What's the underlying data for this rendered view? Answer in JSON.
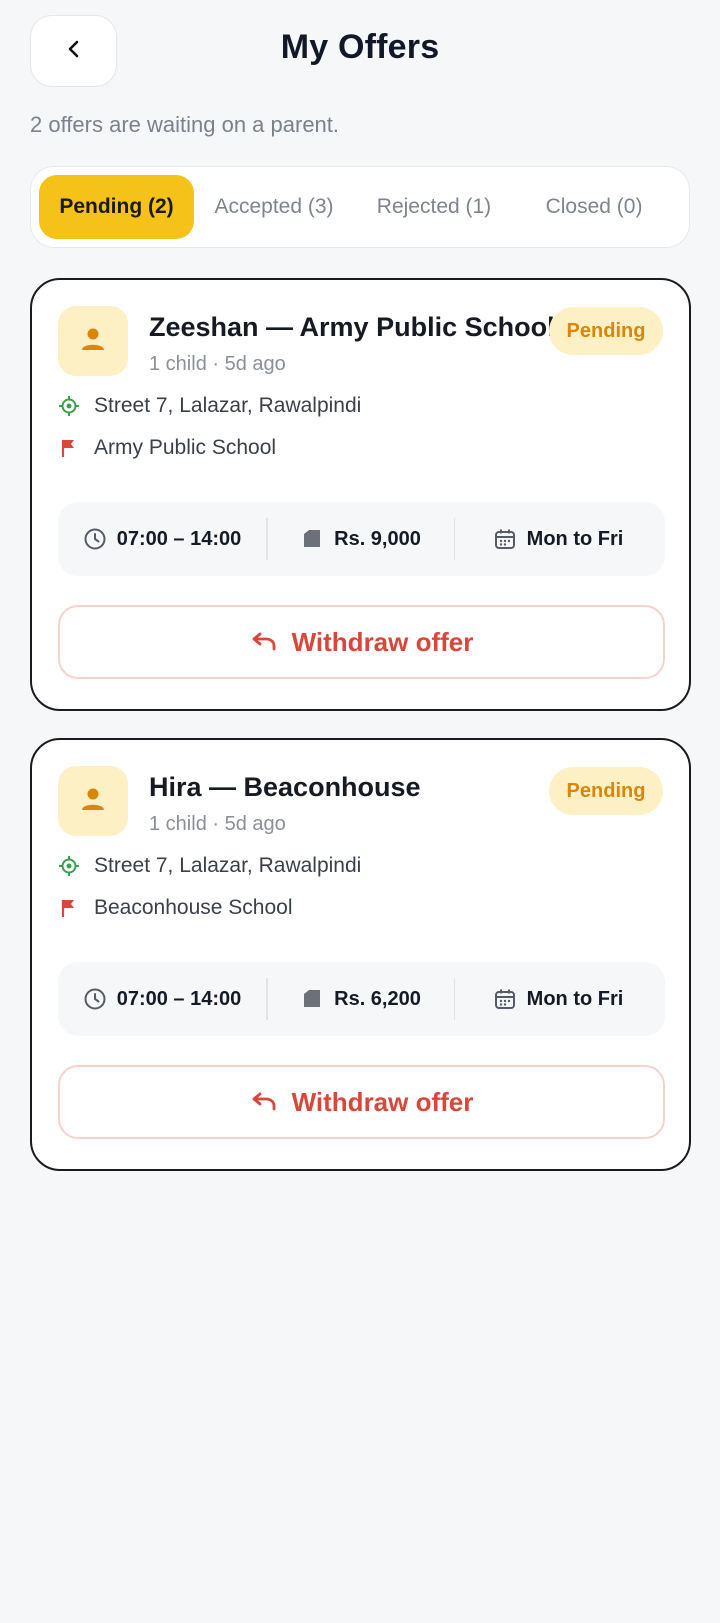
{
  "header": {
    "title": "My Offers",
    "back_icon": "chevron-left-icon"
  },
  "subtitle": "2 offers are waiting on a parent.",
  "tabs": [
    {
      "label": "Pending (2)",
      "active": true
    },
    {
      "label": "Accepted (3)",
      "active": false
    },
    {
      "label": "Rejected (1)",
      "active": false
    },
    {
      "label": "Closed (0)",
      "active": false
    }
  ],
  "colors": {
    "accent": "#f5c21a",
    "badge_text": "#d9860a",
    "danger": "#d9463a",
    "location": "#3aa04a"
  },
  "offers": [
    {
      "title": "Zeeshan — Army Public School",
      "status": "Pending",
      "meta": "1 child · 5d ago",
      "address": "Street 7, Lalazar, Rawalpindi",
      "school": "Army Public School",
      "time": "07:00 – 14:00",
      "price": "Rs. 9,000",
      "days": "Mon to Fri",
      "action": "Withdraw offer"
    },
    {
      "title": "Hira — Beaconhouse",
      "status": "Pending",
      "meta": "1 child · 5d ago",
      "address": "Street 7, Lalazar, Rawalpindi",
      "school": "Beaconhouse School",
      "time": "07:00 – 14:00",
      "price": "Rs. 6,200",
      "days": "Mon to Fri",
      "action": "Withdraw offer"
    }
  ]
}
